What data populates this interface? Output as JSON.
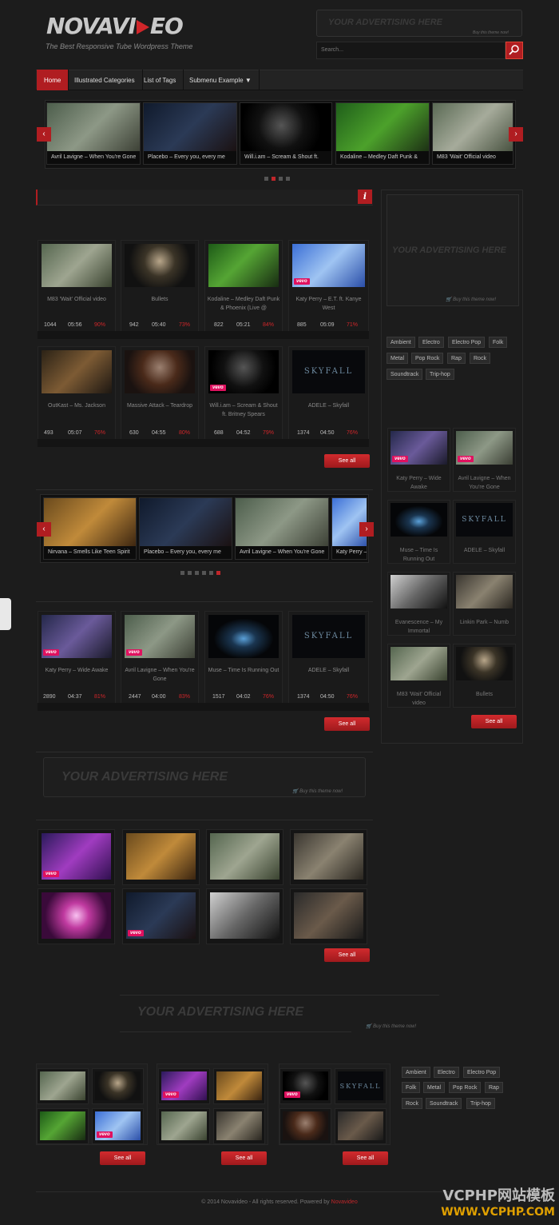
{
  "header": {
    "logo_a": "NOVAVI",
    "logo_b": "EO",
    "tagline": "The Best Responsive Tube Wordpress Theme",
    "ad_text": "YOUR ADVERTISING HERE",
    "buy_text": "Buy this theme now!",
    "search_placeholder": "Search..."
  },
  "nav": [
    "Home",
    "Illustrated Categories",
    "List of Tags",
    "Submenu Example ▼"
  ],
  "slider1": [
    "Avril Lavigne – When You're Gone",
    "Placebo – Every you, every me",
    "Will.i.am – Scream & Shout ft.",
    "Kodaline – Medley Daft Punk &",
    "M83 'Wait' Official video"
  ],
  "grid1": [
    {
      "title": "M83 'Wait' Official video",
      "views": "1044",
      "time": "05:56",
      "rate": "90%"
    },
    {
      "title": "Bullets",
      "views": "942",
      "time": "05:40",
      "rate": "73%"
    },
    {
      "title": "Kodaline – Medley Daft Punk & Phoenix (Live @",
      "views": "822",
      "time": "05:21",
      "rate": "84%"
    },
    {
      "title": "Katy Perry – E.T. ft. Kanye West",
      "views": "885",
      "time": "05:09",
      "rate": "71%"
    },
    {
      "title": "OutKast – Ms. Jackson",
      "views": "493",
      "time": "05:07",
      "rate": "76%"
    },
    {
      "title": "Massive Attack – Teardrop",
      "views": "630",
      "time": "04:55",
      "rate": "80%"
    },
    {
      "title": "Will.i.am – Scream & Shout ft. Britney Spears",
      "views": "688",
      "time": "04:52",
      "rate": "79%"
    },
    {
      "title": "ADELE – Skyfall",
      "views": "1374",
      "time": "04:50",
      "rate": "76%"
    }
  ],
  "see_all": "See all",
  "slider2": [
    "Nirvana – Smells Like Teen Spirit",
    "Placebo – Every you, every me",
    "Avril Lavigne – When You're Gone",
    "Katy Perry –"
  ],
  "grid2": [
    {
      "title": "Katy Perry – Wide Awake",
      "views": "2890",
      "time": "04:37",
      "rate": "81%"
    },
    {
      "title": "Avril Lavigne – When You're Gone",
      "views": "2447",
      "time": "04:00",
      "rate": "83%"
    },
    {
      "title": "Muse – Time Is Running Out",
      "views": "1517",
      "time": "04:02",
      "rate": "76%"
    },
    {
      "title": "ADELE – Skyfall",
      "views": "1374",
      "time": "04:50",
      "rate": "76%"
    }
  ],
  "tags": [
    "Ambient",
    "Electro",
    "Electro Pop",
    "Folk",
    "Metal",
    "Pop Rock",
    "Rap",
    "Rock",
    "Soundtrack",
    "Trip-hop"
  ],
  "side": [
    "Katy Perry – Wide Awake",
    "Avril Lavigne – When You're Gone",
    "Muse – Time Is Running Out",
    "ADELE – Skyfall",
    "Evanescence – My Immortal",
    "Linkin Park – Numb",
    "M83 'Wait' Official video",
    "Bullets"
  ],
  "vevo": "vevo",
  "skyfall": "SKYFALL",
  "footer": {
    "text": "© 2014 Novavideo - All rights reserved. Powered by ",
    "link": "Novavideo"
  },
  "watermark": {
    "line1": "VCPHP网站模板",
    "line2": "WWW.VCPHP.COM"
  },
  "colors": {
    "accent": "#b01d21",
    "bg": "#1c1c1c"
  }
}
